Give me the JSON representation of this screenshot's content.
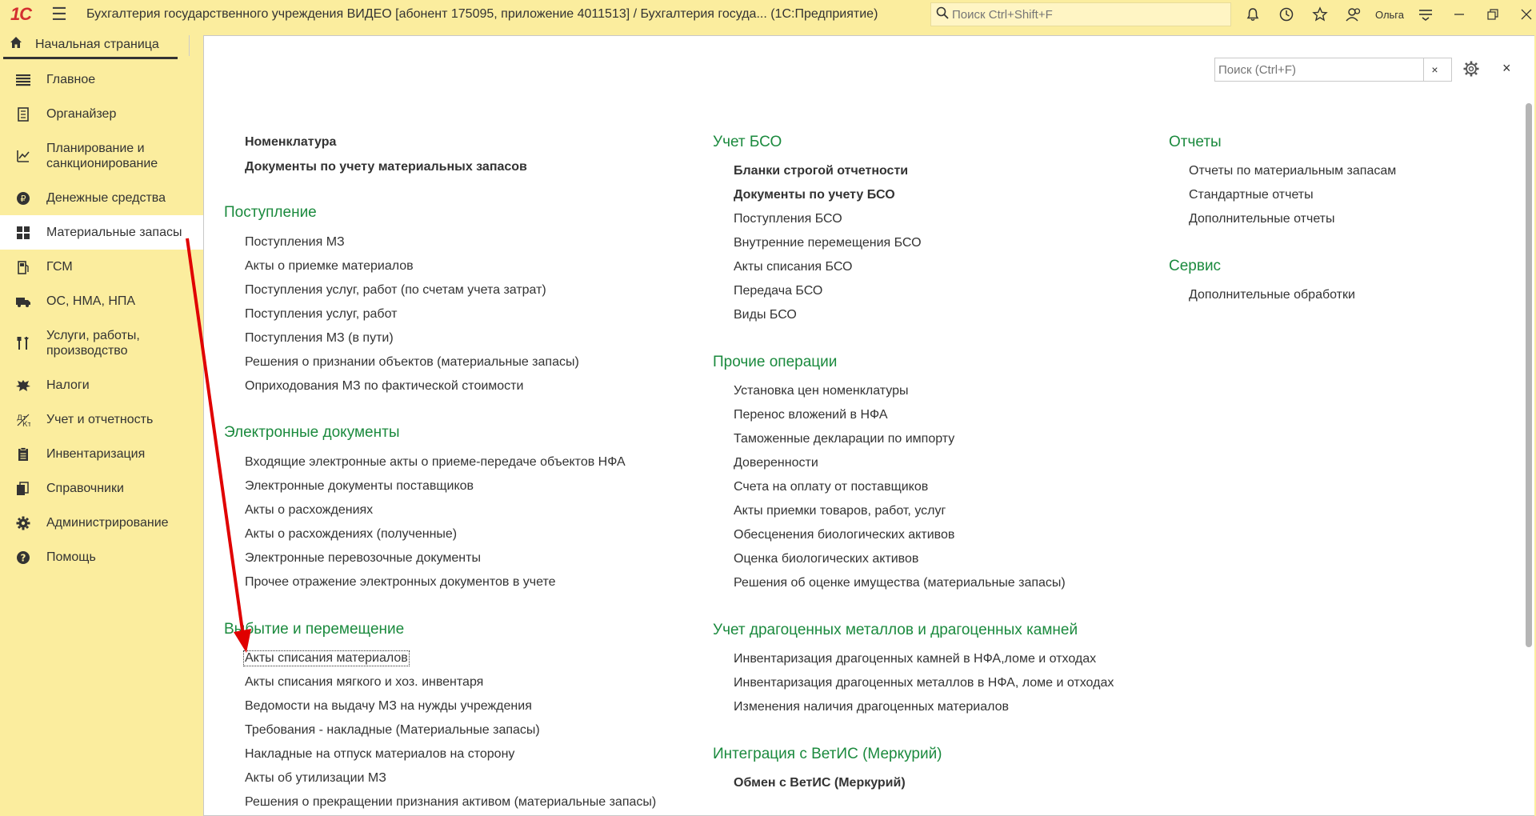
{
  "titlebar": {
    "logo": "1С",
    "title": "Бухгалтерия государственного учреждения ВИДЕО [абонент 175095, приложение 4011513] / Бухгалтерия госуда...  (1С:Предприятие)",
    "search_placeholder": "Поиск Ctrl+Shift+F",
    "user": "Ольга"
  },
  "tabs": {
    "home_label": "Начальная страница"
  },
  "sidebar": {
    "items": [
      {
        "label": "Главное",
        "icon": "list-icon"
      },
      {
        "label": "Органайзер",
        "icon": "notebook-icon"
      },
      {
        "label": "Планирование и санкционирование",
        "icon": "planning-icon"
      },
      {
        "label": "Денежные средства",
        "icon": "coin-icon"
      },
      {
        "label": "Материальные запасы",
        "icon": "grid-icon"
      },
      {
        "label": "ГСМ",
        "icon": "fuel-icon"
      },
      {
        "label": "ОС, НМА, НПА",
        "icon": "truck-icon"
      },
      {
        "label": "Услуги, работы, производство",
        "icon": "tools-icon"
      },
      {
        "label": "Налоги",
        "icon": "emblem-icon"
      },
      {
        "label": "Учет и отчетность",
        "icon": "accounting-icon"
      },
      {
        "label": "Инвентаризация",
        "icon": "clipboard-icon"
      },
      {
        "label": "Справочники",
        "icon": "books-icon"
      },
      {
        "label": "Администрирование",
        "icon": "gear-icon"
      },
      {
        "label": "Помощь",
        "icon": "help-icon"
      }
    ]
  },
  "panel": {
    "search_placeholder": "Поиск (Ctrl+F)",
    "clear": "×",
    "close": "×"
  },
  "col1": {
    "top_links": [
      "Номенклатура",
      "Документы по учету материальных запасов"
    ],
    "sections": [
      {
        "title": "Поступление",
        "links": [
          "Поступления МЗ",
          "Акты о приемке материалов",
          "Поступления услуг, работ (по счетам учета затрат)",
          "Поступления услуг, работ",
          "Поступления МЗ (в пути)",
          "Решения о признании объектов (материальные запасы)",
          "Оприходования МЗ по фактической стоимости"
        ]
      },
      {
        "title": "Электронные документы",
        "links": [
          "Входящие электронные акты о приеме-передаче объектов НФА",
          "Электронные документы поставщиков",
          "Акты о расхождениях",
          "Акты о расхождениях (полученные)",
          "Электронные перевозочные документы",
          "Прочее отражение электронных документов в учете"
        ]
      },
      {
        "title": "Выбытие и перемещение",
        "links": [
          "Акты списания материалов",
          "Акты списания мягкого и хоз. инвентаря",
          "Ведомости на выдачу МЗ на нужды учреждения",
          "Требования - накладные (Материальные запасы)",
          "Накладные на отпуск материалов на сторону",
          "Акты об утилизации МЗ",
          "Решения о прекращении признания активом (материальные запасы)"
        ]
      }
    ]
  },
  "col2": {
    "sections": [
      {
        "title": "Учет БСО",
        "bold_links": [
          "Бланки строгой отчетности",
          "Документы по учету БСО"
        ],
        "links": [
          "Поступления БСО",
          "Внутренние перемещения БСО",
          "Акты списания БСО",
          "Передача БСО",
          "Виды БСО"
        ]
      },
      {
        "title": "Прочие операции",
        "bold_links": [],
        "links": [
          "Установка цен номенклатуры",
          "Перенос вложений в НФА",
          "Таможенные декларации по импорту",
          "Доверенности",
          "Счета на оплату от поставщиков",
          "Акты приемки товаров, работ, услуг",
          "Обесценения биологических активов",
          "Оценка биологических активов",
          "Решения об оценке имущества (материальные запасы)"
        ]
      },
      {
        "title": "Учет драгоценных металлов и драгоценных камней",
        "bold_links": [],
        "links": [
          "Инвентаризация драгоценных камней в НФА,ломе и отходах",
          "Инвентаризация драгоценных металлов в НФА, ломе и отходах",
          "Изменения наличия драгоценных материалов"
        ]
      },
      {
        "title": "Интеграция с ВетИС (Меркурий)",
        "bold_links": [
          "Обмен с ВетИС (Меркурий)"
        ],
        "links": []
      }
    ]
  },
  "col3": {
    "sections": [
      {
        "title": "Отчеты",
        "links": [
          "Отчеты по материальным запасам",
          "Стандартные отчеты",
          "Дополнительные отчеты"
        ]
      },
      {
        "title": "Сервис",
        "links": [
          "Дополнительные обработки"
        ]
      }
    ]
  },
  "colors": {
    "background": "#fbed9e",
    "section_heading": "#1b8a3e",
    "annotation_arrow": "#e00000"
  }
}
